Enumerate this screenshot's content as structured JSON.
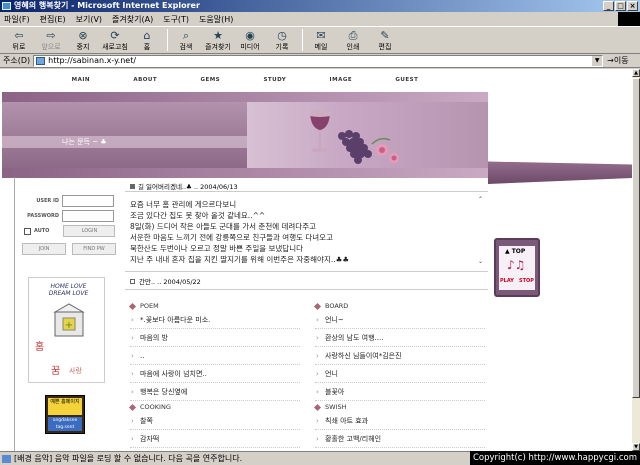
{
  "window": {
    "title": "영혜의 행복찾기 - Microsoft Internet Explorer"
  },
  "menu": [
    "파일(F)",
    "편집(E)",
    "보기(V)",
    "즐겨찾기(A)",
    "도구(T)",
    "도움말(H)"
  ],
  "toolbar": {
    "back": "뒤로",
    "forward": "앞으로",
    "stop": "중지",
    "refresh": "새로고침",
    "home": "홈",
    "search": "검색",
    "favorites": "즐겨찾기",
    "media": "미디어",
    "history": "기록",
    "mail": "메일",
    "print": "인쇄",
    "edit": "편집"
  },
  "address": {
    "label": "주소(D)",
    "url": "http://sabinan.x-y.net/",
    "go": "이동"
  },
  "nav": [
    "MAIN",
    "ABOUT",
    "GEMS",
    "STUDY",
    "IMAGE",
    "GUEST"
  ],
  "banner": {
    "motto": "나는 문득 ~ ♣"
  },
  "login": {
    "userid": "USER ID",
    "password": "PASSWORD",
    "auto": "AUTO",
    "login_btn": "LOGIN",
    "join_btn": "JOIN",
    "find_btn": "FIND PW"
  },
  "promo": {
    "text": "HOME LOVE DREAM LOVE",
    "tags": [
      "홈",
      "꿈",
      "사랑"
    ]
  },
  "badge": {
    "top": "예쁜 홈페이지",
    "bottom": "ongdaksee tag.sent"
  },
  "post1": {
    "title": "길 잃어버리겠네..♣ .. 2004/06/13",
    "lines": [
      "요즘 너무 홈 관리에 게으르다보니",
      "조금 있다간 집도 못 찾아 올것 같네요..^^",
      "8일(화) 드디어 작은 아들도 군대를 가서 춘천에 데려다주고",
      "서운한 마음도 느끼기 전에 강릉쪽으로 친구들과 여행도 다녀오고",
      "북한산도 두번이나 오르고 정말 바쁜 주일을 보냈답니다",
      "지난 주 내내 혼자 집을 지킨 딸지기를 위해 이번주은 자중해야지..♣♣"
    ]
  },
  "post2": {
    "title": "간만.. .. 2004/05/22"
  },
  "boards": {
    "poem": {
      "title": "POEM",
      "items": [
        "*.꽃보다 아름다운 미소.",
        "마음의 방",
        "..",
        "마음에 사랑이 넘치면..",
        "행복은 당신옆에"
      ]
    },
    "board": {
      "title": "BOARD",
      "items": [
        "언니~",
        "환상의 남도 여행....",
        "사랑하신 님들이여*김은진",
        "언니",
        "블꽃아"
      ]
    },
    "cooking": {
      "title": "COOKING",
      "items": [
        "찰쪽",
        "감자떡"
      ]
    },
    "swish": {
      "title": "SWISH",
      "items": [
        "칙쇄 아트 효과",
        "황홀한 고백/리헤인"
      ]
    }
  },
  "topwidget": {
    "top": "▲ TOP",
    "play": "PLAY",
    "stop": "STOP"
  },
  "status": {
    "text": "[배경 음악] 음악 파일을 로딩 할 수 없습니다. 다음 곡을 연주합니다.",
    "copyright": "Copyright(c) http://www.happycgi.com"
  }
}
